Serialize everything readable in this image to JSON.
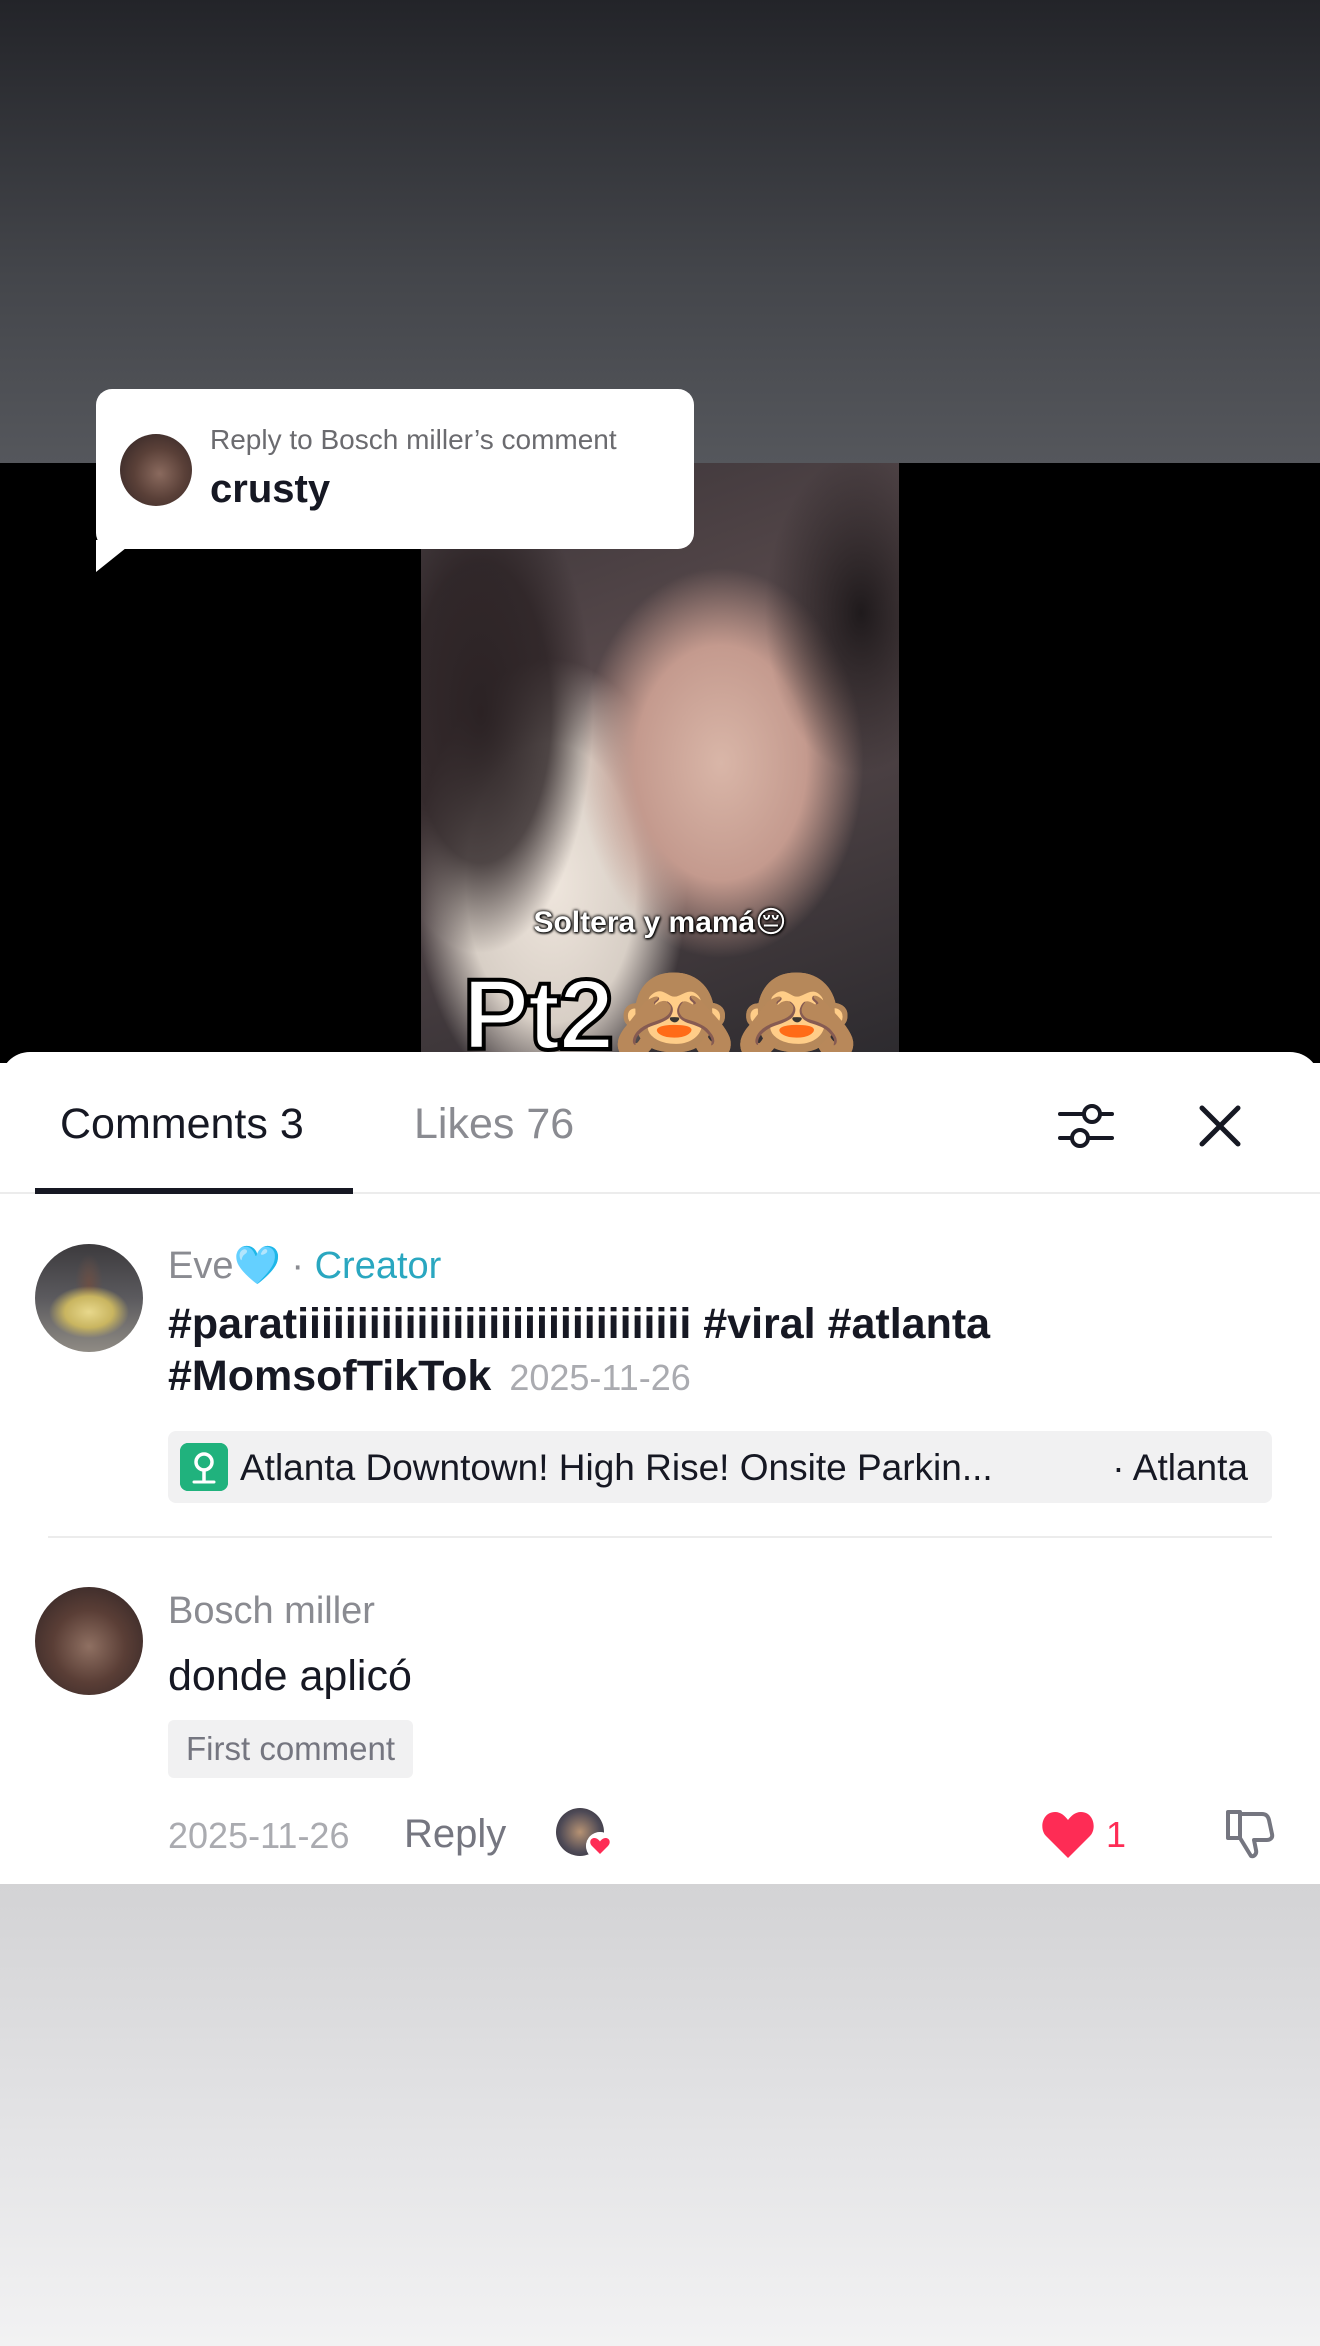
{
  "video": {
    "caption_small": "Soltera y mamá😔",
    "caption_big": "Pt2🙈🙈"
  },
  "reply_bubble": {
    "label": "Reply to Bosch miller’s comment",
    "text": "crusty"
  },
  "tabs": {
    "comments": "Comments 3",
    "likes": "Likes 76"
  },
  "icons": {
    "filter": "filter-icon",
    "close": "close-icon",
    "location": "location-pin-icon",
    "heart": "heart-icon",
    "dislike": "thumbs-down-icon"
  },
  "comments": [
    {
      "author": "Eve",
      "author_badge": "🩵",
      "separator": " · ",
      "role": "Creator",
      "text": "#paratiiiiiiiiiiiiiiiiiiiiiiiiiiiiiiiii #viral #atlanta #MomsofTikTok",
      "date": "2025-11-26",
      "location": {
        "name": "Atlanta Downtown! High Rise! Onsite Parkin...",
        "city": "· Atlanta"
      }
    },
    {
      "author": "Bosch miller",
      "text": "donde aplicó",
      "badge": "First comment",
      "date": "2025-11-26",
      "reply_label": "Reply",
      "likes": "1"
    }
  ],
  "colors": {
    "accent_red": "#fe2c55",
    "creator_teal": "#2aa7c0",
    "location_green": "#20b27d"
  }
}
